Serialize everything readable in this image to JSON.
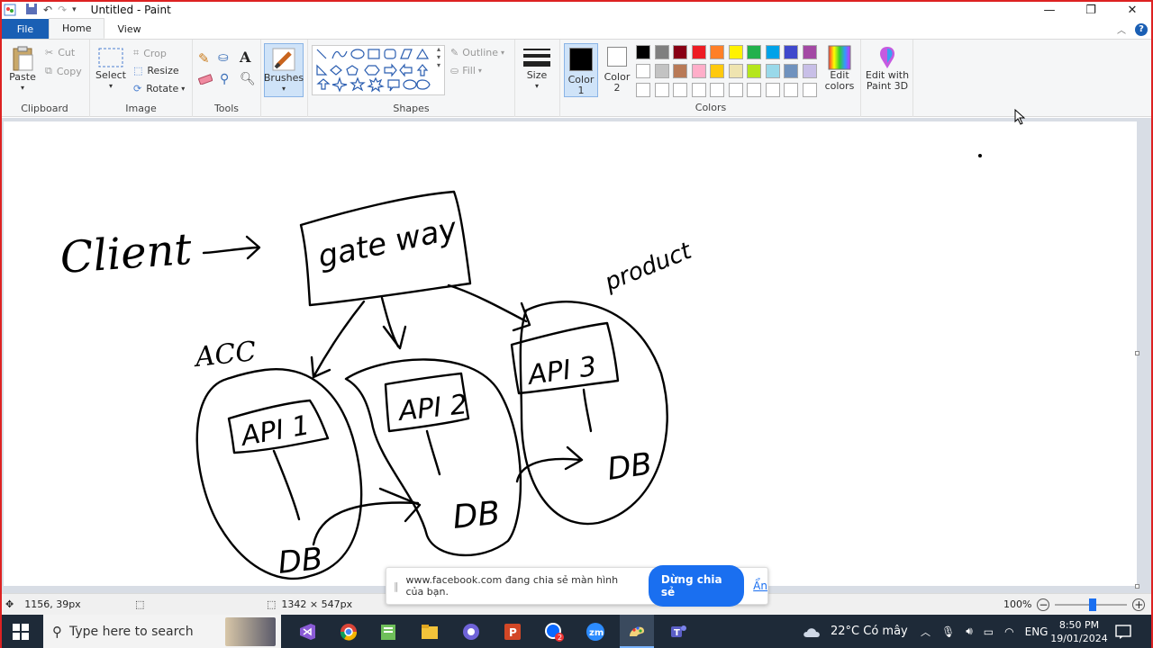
{
  "window": {
    "title": "Untitled - Paint",
    "controls": {
      "minimize": "—",
      "maximize": "❐",
      "close": "✕"
    }
  },
  "tabs": [
    {
      "label": "File",
      "active": false
    },
    {
      "label": "Home",
      "active": true
    },
    {
      "label": "View",
      "active": false
    }
  ],
  "ribbon": {
    "clipboard": {
      "label": "Clipboard",
      "paste": "Paste",
      "cut": "Cut",
      "copy": "Copy"
    },
    "image": {
      "label": "Image",
      "select": "Select",
      "crop": "Crop",
      "resize": "Resize",
      "rotate": "Rotate"
    },
    "tools": {
      "label": "Tools"
    },
    "brushes": {
      "label": "Brushes"
    },
    "shapes": {
      "label": "Shapes",
      "outline": "Outline",
      "fill": "Fill"
    },
    "size": {
      "label": "Size"
    },
    "colors": {
      "label": "Colors",
      "color1": "Color 1",
      "color2": "Color 2",
      "edit": "Edit colors",
      "paint3d": "Edit with Paint 3D",
      "row1": [
        "#000000",
        "#7f7f7f",
        "#880015",
        "#ed1c24",
        "#ff7f27",
        "#fff200",
        "#22b14c",
        "#00a2e8",
        "#3f48cc",
        "#a349a4"
      ],
      "row2": [
        "#ffffff",
        "#c3c3c3",
        "#b97a57",
        "#ffaec9",
        "#ffc90e",
        "#efe4b0",
        "#b5e61d",
        "#99d9ea",
        "#7092be",
        "#c8bfe7"
      ]
    }
  },
  "canvas": {
    "labels": {
      "client": "Client",
      "gateway": "gate way",
      "product": "product",
      "acc": "ACC",
      "api1": "API 1",
      "api2": "API 2",
      "api3": "API 3",
      "db": "DB"
    }
  },
  "status": {
    "cursor": "1156, 39px",
    "size": "1342 × 547px",
    "zoom": "100%"
  },
  "share_banner": {
    "message": "www.facebook.com đang chia sẻ màn hình của bạn.",
    "stop": "Dừng chia sẻ",
    "hide": "Ẩn"
  },
  "taskbar": {
    "search_placeholder": "Type here to search",
    "weather": "22°C  Có mây",
    "lang": "ENG",
    "time": "8:50 PM",
    "date": "19/01/2024",
    "badge": "2"
  }
}
